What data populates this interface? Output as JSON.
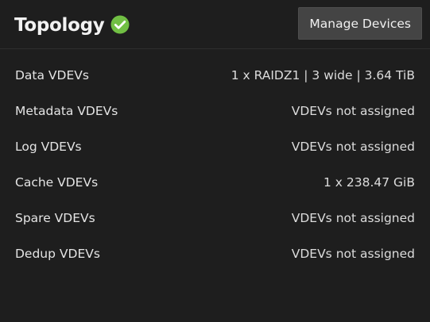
{
  "header": {
    "title": "Topology",
    "status_icon": "check-circle-icon",
    "status_color": "#71bf44",
    "manage_button_label": "Manage Devices"
  },
  "rows": [
    {
      "label": "Data VDEVs",
      "value": "1 x RAIDZ1 | 3 wide | 3.64 TiB"
    },
    {
      "label": "Metadata VDEVs",
      "value": "VDEVs not assigned"
    },
    {
      "label": "Log VDEVs",
      "value": "VDEVs not assigned"
    },
    {
      "label": "Cache VDEVs",
      "value": "1 x 238.47 GiB"
    },
    {
      "label": "Spare VDEVs",
      "value": "VDEVs not assigned"
    },
    {
      "label": "Dedup VDEVs",
      "value": "VDEVs not assigned"
    }
  ]
}
